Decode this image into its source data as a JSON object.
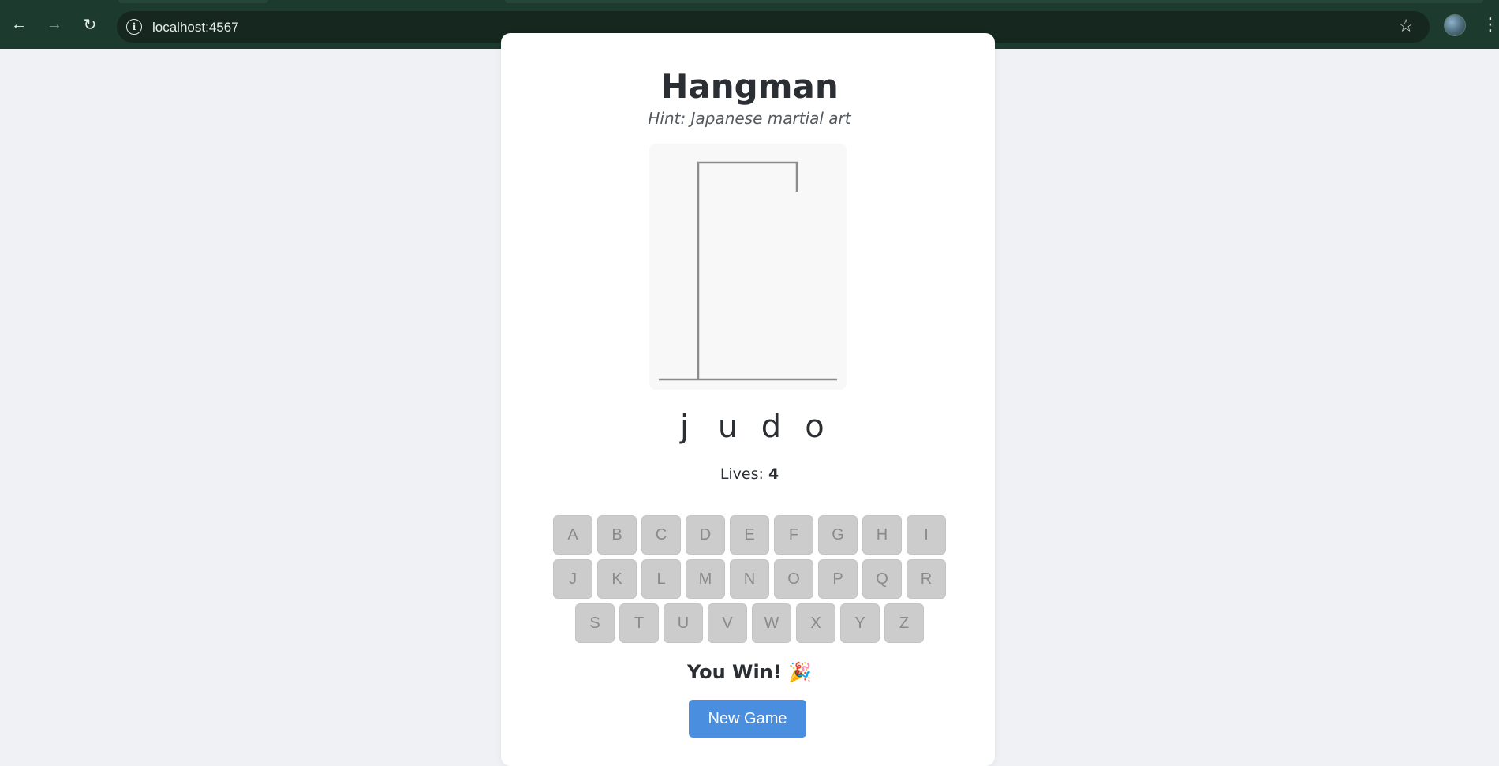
{
  "browser": {
    "back_glyph": "←",
    "forward_glyph": "→",
    "reload_glyph": "↻",
    "info_glyph": "i",
    "url": "localhost:4567",
    "star_glyph": "☆",
    "menu_glyph": "⋮"
  },
  "game": {
    "title": "Hangman",
    "hint": "Hint: Japanese martial art",
    "word_letters": [
      "j",
      "u",
      "d",
      "o"
    ],
    "lives_label": "Lives: ",
    "lives_value": "4",
    "keyboard_rows": [
      [
        "A",
        "B",
        "C",
        "D",
        "E",
        "F",
        "G",
        "H",
        "I"
      ],
      [
        "J",
        "K",
        "L",
        "M",
        "N",
        "O",
        "P",
        "Q",
        "R"
      ],
      [
        "S",
        "T",
        "U",
        "V",
        "W",
        "X",
        "Y",
        "Z"
      ]
    ],
    "result": "You Win! 🎉",
    "new_game_label": "New Game"
  },
  "colors": {
    "chrome_bg": "#1d3a2e",
    "page_bg": "#eff1f5",
    "key_disabled_bg": "#cccccc",
    "button_bg": "#4a8fdf"
  },
  "icons": {
    "back": "arrow-left-icon",
    "forward": "arrow-right-icon",
    "reload": "reload-icon",
    "site_info": "info-icon",
    "bookmark": "star-icon",
    "menu": "kebab-menu-icon"
  }
}
